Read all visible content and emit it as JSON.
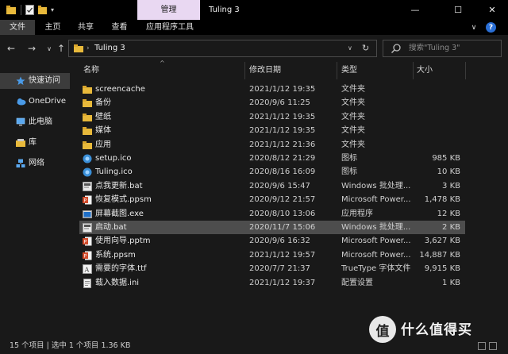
{
  "title_bar": {
    "manage_tab": "管理",
    "window_title": "Tuling 3",
    "min_glyph": "—",
    "max_glyph": "☐",
    "close_glyph": "✕",
    "qa_down_glyph": "▾"
  },
  "ribbon": {
    "tabs": [
      "文件",
      "主页",
      "共享",
      "查看",
      "应用程序工具"
    ],
    "expand_glyph": "∨",
    "help_glyph": "?"
  },
  "address_bar": {
    "back_glyph": "←",
    "forward_glyph": "→",
    "recent_glyph": "∨",
    "up_glyph": "↑",
    "path_sep": "›",
    "path": "Tuling 3",
    "drop_glyph": "∨",
    "refresh_glyph": "↻",
    "search_placeholder": "搜索\"Tuling 3\""
  },
  "sidebar": {
    "items": [
      {
        "label": "快速访问",
        "icon": "star-icon"
      },
      {
        "label": "OneDrive",
        "icon": "cloud-icon"
      },
      {
        "label": "此电脑",
        "icon": "computer-icon"
      },
      {
        "label": "库",
        "icon": "library-icon"
      },
      {
        "label": "网络",
        "icon": "network-icon"
      }
    ]
  },
  "columns": {
    "name": "名称",
    "date": "修改日期",
    "type": "类型",
    "size": "大小",
    "sort_glyph": "^"
  },
  "files": [
    {
      "name": "screencache",
      "date": "2021/1/12 19:35",
      "type": "文件夹",
      "size": "",
      "icon": "folder-icon"
    },
    {
      "name": "备份",
      "date": "2020/9/6 11:25",
      "type": "文件夹",
      "size": "",
      "icon": "folder-icon"
    },
    {
      "name": "壁纸",
      "date": "2021/1/12 19:35",
      "type": "文件夹",
      "size": "",
      "icon": "folder-icon"
    },
    {
      "name": "媒体",
      "date": "2021/1/12 19:35",
      "type": "文件夹",
      "size": "",
      "icon": "folder-icon"
    },
    {
      "name": "应用",
      "date": "2021/1/12 21:36",
      "type": "文件夹",
      "size": "",
      "icon": "folder-icon"
    },
    {
      "name": "setup.ico",
      "date": "2020/8/12 21:29",
      "type": "图标",
      "size": "985 KB",
      "icon": "ico-file-icon"
    },
    {
      "name": "Tuling.ico",
      "date": "2020/8/16 16:09",
      "type": "图标",
      "size": "10 KB",
      "icon": "ico-file-icon"
    },
    {
      "name": "点我更新.bat",
      "date": "2020/9/6 15:47",
      "type": "Windows 批处理...",
      "size": "3 KB",
      "icon": "bat-file-icon"
    },
    {
      "name": "恢复模式.ppsm",
      "date": "2020/9/12 21:57",
      "type": "Microsoft Power...",
      "size": "1,478 KB",
      "icon": "ppsm-file-icon"
    },
    {
      "name": "屏幕截图.exe",
      "date": "2020/8/10 13:06",
      "type": "应用程序",
      "size": "12 KB",
      "icon": "exe-file-icon"
    },
    {
      "name": "启动.bat",
      "date": "2020/11/7 15:06",
      "type": "Windows 批处理...",
      "size": "2 KB",
      "icon": "bat-file-icon"
    },
    {
      "name": "使用向导.pptm",
      "date": "2020/9/6 16:32",
      "type": "Microsoft Power...",
      "size": "3,627 KB",
      "icon": "ppsm-file-icon"
    },
    {
      "name": "系统.ppsm",
      "date": "2021/1/12 19:57",
      "type": "Microsoft Power...",
      "size": "14,887 KB",
      "icon": "ppsm-file-icon"
    },
    {
      "name": "需要的字体.ttf",
      "date": "2020/7/7 21:37",
      "type": "TrueType 字体文件",
      "size": "9,915 KB",
      "icon": "ttf-file-icon"
    },
    {
      "name": "载入数据.ini",
      "date": "2021/1/12 19:37",
      "type": "配置设置",
      "size": "1 KB",
      "icon": "ini-file-icon"
    }
  ],
  "selected_index": 10,
  "status_bar": {
    "text": "15 个项目  |  选中 1 个项目  1.36 KB"
  },
  "watermark": {
    "logo_glyph": "值",
    "text": "什么值得买"
  },
  "colors": {
    "background": "#191919",
    "chrome": "#000000",
    "manage_tab": "#e9d8f2",
    "selection": "#4d4d4d",
    "folder": "#e8b93b",
    "accent_blue": "#2a6fd6"
  }
}
